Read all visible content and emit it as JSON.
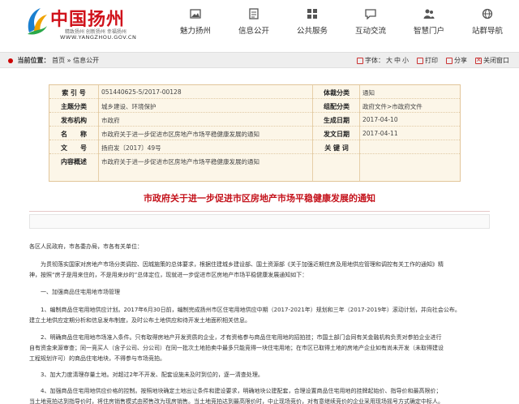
{
  "header": {
    "site_title": "中国扬州",
    "slogan": "精致扬州 创新扬州 幸福扬州",
    "url": "WWW.YANGZHOU.GOV.CN",
    "nav": [
      {
        "label": "魅力扬州",
        "icon": "picture-icon"
      },
      {
        "label": "信息公开",
        "icon": "document-icon"
      },
      {
        "label": "公共服务",
        "icon": "grid-icon"
      },
      {
        "label": "互动交流",
        "icon": "chat-icon"
      },
      {
        "label": "智慧门户",
        "icon": "people-icon"
      },
      {
        "label": "站群导航",
        "icon": "network-icon"
      }
    ]
  },
  "breadcrumb": {
    "label": "当前位置：",
    "home": "首页",
    "sep": "»",
    "current": "信息公开",
    "tools": {
      "font_size": "字体：",
      "large": "大",
      "medium": "中",
      "small": "小",
      "print": "打印",
      "share": "分享",
      "close": "关闭窗口"
    }
  },
  "meta": {
    "index_no_label": "索 引 号",
    "index_no": "051440625-5/2017-00128",
    "genre_label": "体裁分类",
    "genre": "通知",
    "topic_label": "主题分类",
    "topic": "城乡建设、环境保护",
    "org_label": "组配分类",
    "org": "政府文件>市政府文件",
    "issuer_label": "发布机构",
    "issuer": "市政府",
    "created_label": "生成日期",
    "created": "2017-04-10",
    "name_label": "名　　称",
    "name": "市政府关于进一步促进市区房地产市场平稳健康发展的通知",
    "published_label": "发文日期",
    "published": "2017-04-11",
    "doc_no_label": "文　　号",
    "doc_no": "扬府发〔2017〕49号",
    "keywords_label": "关 键 词",
    "keywords": "",
    "summary_label": "内容概述",
    "summary": "市政府关于进一步促进市区房地产市场平稳健康发展的通知"
  },
  "article": {
    "title": "市政府关于进一步促进市区房地产市场平稳健康发展的通知",
    "paragraphs": [
      "各区人民政府，市各委办局，市各有关单位：",
      "为贯彻落实国家对房地产市场分类调控、因城施策的总体要求，根据住建城乡建设部、国土资源部《关于加强近期住房及用地供应管理和调控有关工作的通知》精",
      "神，按照“房子是用来住的，不是用来炒的”总体定位，现就进一步促进市区房地产市场平稳健康发展通知如下：",
      "一、加强商品住宅用地市场管理",
      "1、编制商品住宅用地供应计划。2017年6月30日前，编制完成扬州市区住宅用地供应中期（2017-2021年）规划和三年（2017-2019年）滚动计划，并向社会公布。",
      "建立土地供应定期分析和信息发布制度，及时公布土地供应和待开发土地面积相关信息。",
      "2、明确商品住宅用地市场准入条件。只有取得房地产开发资质的企业，才有资格参与商品住宅用地的招拍挂；市国土部门会同有关金融机构负责对参拍企业进行",
      "自有资金来源审查；同一竞买人（含子公司、分公司）在同一批次土地拍卖中最多只能竞得一块住宅用地；在市区已取得土地的房地产企业如有尚未开发（未取得建设",
      "工程规划许可）的商品住宅地块，不得参与市场竞拍。",
      "3、加大力度清理存量土地。对超过2年不开发、配套设施未及时到位的，逐一清查处理。",
      "4、加强商品住宅用地供应价格的控制。按照地块确定土地出让条件和建设要求，明确地块公建配套，合理设置商品住宅用地的挂牌起始价、指导价和最高限价；",
      "当土地竞拍达到指导价时，将住房销售模式由预售改为现房销售。当土地竞拍达到最高限价时，中止现场竞价，对有意继续竞价的企业采用现场摇号方式确定中标人。"
    ]
  }
}
